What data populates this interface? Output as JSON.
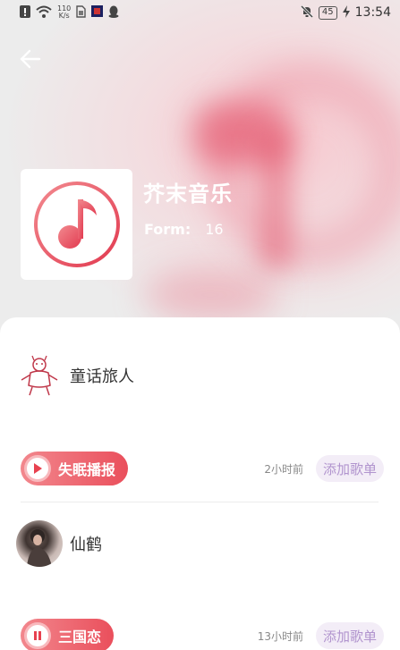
{
  "status_bar": {
    "net_speed_value": "110",
    "net_speed_unit": "K/s",
    "battery": "45",
    "time": "13:54"
  },
  "header": {
    "title": "芥末音乐",
    "form_label": "Form:",
    "form_count": "16"
  },
  "entries": [
    {
      "user_name": "童话旅人",
      "track_name": "失眠播报",
      "time_ago": "2小时前",
      "add_label": "添加歌单",
      "state": "paused"
    },
    {
      "user_name": "仙鹤",
      "track_name": "三国恋",
      "time_ago": "13小时前",
      "add_label": "添加歌单",
      "state": "playing"
    }
  ],
  "colors": {
    "accent": "#ea4f5c",
    "add_bg": "#f3edf7",
    "add_text": "#b194ce"
  }
}
